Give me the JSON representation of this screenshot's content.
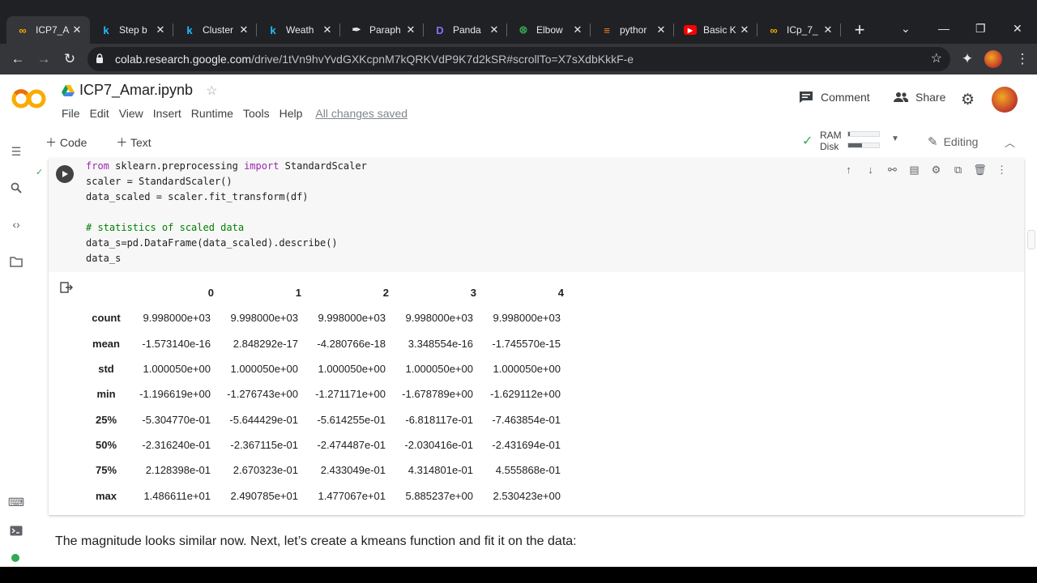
{
  "browser": {
    "tabs": [
      {
        "favicon": "colab-icon",
        "title": "ICP7_A",
        "active": true
      },
      {
        "favicon": "kaggle-icon",
        "title": "Step b"
      },
      {
        "favicon": "kaggle-icon",
        "title": "Cluster"
      },
      {
        "favicon": "kaggle-icon",
        "title": "Weath"
      },
      {
        "favicon": "quill-icon",
        "title": "Paraph"
      },
      {
        "favicon": "pandas-icon",
        "title": "Panda"
      },
      {
        "favicon": "elbow-icon",
        "title": "Elbow"
      },
      {
        "favicon": "stackoverflow-icon",
        "title": "pythor"
      },
      {
        "favicon": "youtube-icon",
        "title": "Basic K"
      },
      {
        "favicon": "colab-icon",
        "title": "ICp_7_"
      }
    ],
    "url_domain": "colab.research.google.com",
    "url_path": "/drive/1tVn9hvYvdGXKcpnM7kQRKVdP9K7d2kSR#scrollTo=X7sXdbKkkF-e"
  },
  "colab": {
    "notebook_title": "ICP7_Amar.ipynb",
    "menu": [
      "File",
      "Edit",
      "View",
      "Insert",
      "Runtime",
      "Tools",
      "Help"
    ],
    "saved_status": "All changes saved",
    "comment_label": "Comment",
    "share_label": "Share",
    "add_code": "Code",
    "add_text": "Text",
    "ram_label": "RAM",
    "disk_label": "Disk",
    "ram_usage": 0.05,
    "disk_usage": 0.45,
    "editing_label": "Editing"
  },
  "cell": {
    "code_lines": [
      [
        {
          "t": "from",
          "c": "kw"
        },
        {
          "t": " sklearn.preprocessing "
        },
        {
          "t": "import",
          "c": "kw"
        },
        {
          "t": " StandardScaler"
        }
      ],
      [
        {
          "t": "scaler = StandardScaler()"
        }
      ],
      [
        {
          "t": "data_scaled = scaler.fit_transform(df)"
        }
      ],
      [
        {
          "t": ""
        }
      ],
      [
        {
          "t": "# statistics of scaled data",
          "c": "cm"
        }
      ],
      [
        {
          "t": "data_s=pd.DataFrame(data_scaled).describe()"
        }
      ],
      [
        {
          "t": "data_s"
        }
      ]
    ],
    "table": {
      "columns": [
        "",
        "0",
        "1",
        "2",
        "3",
        "4"
      ],
      "rows": [
        {
          "label": "count",
          "values": [
            "9.998000e+03",
            "9.998000e+03",
            "9.998000e+03",
            "9.998000e+03",
            "9.998000e+03"
          ]
        },
        {
          "label": "mean",
          "values": [
            "-1.573140e-16",
            "2.848292e-17",
            "-4.280766e-18",
            "3.348554e-16",
            "-1.745570e-15"
          ]
        },
        {
          "label": "std",
          "values": [
            "1.000050e+00",
            "1.000050e+00",
            "1.000050e+00",
            "1.000050e+00",
            "1.000050e+00"
          ]
        },
        {
          "label": "min",
          "values": [
            "-1.196619e+00",
            "-1.276743e+00",
            "-1.271171e+00",
            "-1.678789e+00",
            "-1.629112e+00"
          ]
        },
        {
          "label": "25%",
          "values": [
            "-5.304770e-01",
            "-5.644429e-01",
            "-5.614255e-01",
            "-6.818117e-01",
            "-7.463854e-01"
          ]
        },
        {
          "label": "50%",
          "values": [
            "-2.316240e-01",
            "-2.367115e-01",
            "-2.474487e-01",
            "-2.030416e-01",
            "-2.431694e-01"
          ]
        },
        {
          "label": "75%",
          "values": [
            "2.128398e-01",
            "2.670323e-01",
            "2.433049e-01",
            "4.314801e-01",
            "4.555868e-01"
          ]
        },
        {
          "label": "max",
          "values": [
            "1.486611e+01",
            "2.490785e+01",
            "1.477067e+01",
            "5.885237e+00",
            "2.530423e+00"
          ]
        }
      ]
    }
  },
  "text_cell": "The magnitude looks similar now. Next, let’s create a kmeans function and fit it on the data:"
}
